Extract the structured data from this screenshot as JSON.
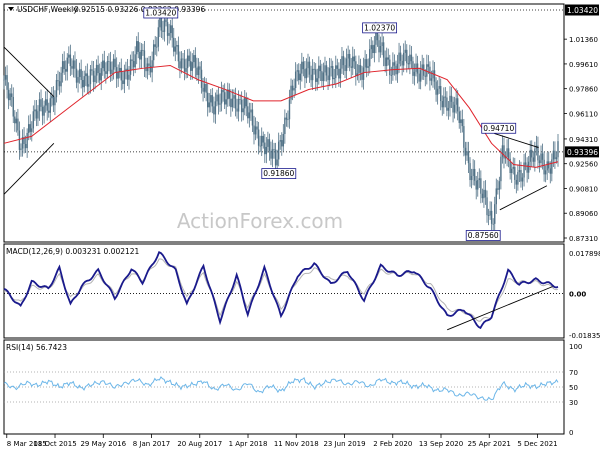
{
  "colors": {
    "background": "#ffffff",
    "candle": "#4f7085",
    "sma": "#e0232b",
    "macd_line": "#1a1a8c",
    "macd_signal": "#b4b4b4",
    "rsi_line": "#6cb6e8",
    "axis": "#000000",
    "grid": "#9a9a9a",
    "label_box": "#1a1a8c",
    "price_badge_bg": "#000000",
    "price_badge_fg": "#ffffff",
    "watermark": "#c8c8c8"
  },
  "watermark": "ActionForex.com",
  "price_panel": {
    "title": "USDCHF,Weekly",
    "ohlc": "0.92515 0.93226 0.92362 0.93396",
    "ylim": [
      0.8731,
      1.0342
    ],
    "y_ticks": [
      "1.03420",
      "1.01360",
      "0.99610",
      "0.97860",
      "0.96110",
      "0.94310",
      "0.92560",
      "0.90810",
      "0.89060",
      "0.87310"
    ],
    "current_price": "0.93396",
    "current_value": 0.93396,
    "top_value": 1.0342,
    "top_label": "1.03420",
    "annotations": [
      {
        "text": "1.03420",
        "x": 28.3,
        "y": 1.0342
      },
      {
        "text": "0.91860",
        "x": 49.6,
        "y": 0.9186
      },
      {
        "text": "1.02370",
        "x": 67.8,
        "y": 1.0237
      },
      {
        "text": "0.94710",
        "x": 89.3,
        "y": 0.9471
      },
      {
        "text": "0.87560",
        "x": 86.5,
        "y": 0.8756
      }
    ]
  },
  "macd_panel": {
    "title": "MACD(12,26,9) 0.003231 0.002121",
    "ylim": [
      -0.0183,
      0.0178
    ],
    "y_ticks": [
      "0.017898",
      "0.00",
      "-0.018354"
    ],
    "current_value": 0.0
  },
  "rsi_panel": {
    "title": "RSI(14) 56.7423",
    "ylim": [
      0,
      100
    ],
    "y_ticks": [
      "100",
      "70",
      "50",
      "30",
      "0"
    ]
  },
  "x_ticks": [
    "8 Mar 2015",
    "18 Oct 2015",
    "29 May 2016",
    "8 Jan 2017",
    "20 Aug 2017",
    "1 Apr 2018",
    "11 Nov 2018",
    "23 Jun 2019",
    "2 Feb 2020",
    "13 Sep 2020",
    "25 Apr 2021",
    "5 Dec 2021"
  ],
  "chart_data": {
    "type": "candlestick",
    "title": "USDCHF,Weekly",
    "x_unit": "date",
    "x_range": [
      "2015-03-08",
      "2022-02-13"
    ],
    "price": {
      "x": [
        0,
        3,
        6,
        9,
        12,
        15,
        18,
        21,
        24,
        26,
        28,
        30,
        32,
        35,
        38,
        41,
        44,
        47,
        49,
        52,
        55,
        58,
        61,
        64,
        67,
        70,
        73,
        76,
        79,
        82,
        84,
        86,
        88,
        90,
        92,
        94,
        96,
        98,
        100
      ],
      "close": [
        0.985,
        0.94,
        0.96,
        0.975,
        1.0,
        0.98,
        0.998,
        0.985,
        1.005,
        0.99,
        1.025,
        1.015,
        1.0,
        0.99,
        0.965,
        0.975,
        0.96,
        0.94,
        0.925,
        0.98,
        0.995,
        0.985,
        0.998,
        0.99,
        1.01,
        0.995,
        0.998,
        0.99,
        0.975,
        0.96,
        0.925,
        0.905,
        0.885,
        0.935,
        0.915,
        0.925,
        0.93,
        0.925,
        0.934
      ]
    },
    "sma": {
      "x": [
        0,
        5,
        10,
        15,
        20,
        25,
        30,
        35,
        40,
        45,
        50,
        55,
        60,
        65,
        70,
        75,
        80,
        84,
        88,
        92,
        96,
        100
      ],
      "values": [
        0.94,
        0.945,
        0.96,
        0.975,
        0.99,
        0.993,
        0.995,
        0.985,
        0.978,
        0.97,
        0.97,
        0.978,
        0.982,
        0.99,
        0.992,
        0.993,
        0.985,
        0.965,
        0.94,
        0.925,
        0.923,
        0.927
      ]
    },
    "macd": {
      "x": [
        0,
        3,
        5,
        8,
        10,
        12,
        14,
        17,
        20,
        23,
        25,
        28,
        31,
        33,
        36,
        39,
        42,
        44,
        47,
        50,
        53,
        56,
        59,
        62,
        65,
        68,
        71,
        74,
        77,
        80,
        83,
        86,
        88,
        91,
        93,
        96,
        100
      ],
      "line": [
        0.002,
        -0.006,
        0.005,
        0.002,
        0.011,
        -0.005,
        0.003,
        0.01,
        -0.002,
        0.011,
        0.005,
        0.018,
        0.01,
        -0.005,
        0.012,
        -0.012,
        0.008,
        -0.009,
        0.011,
        -0.01,
        0.008,
        0.013,
        0.004,
        0.01,
        -0.003,
        0.012,
        0.008,
        0.01,
        0.002,
        -0.01,
        -0.007,
        -0.015,
        -0.01,
        0.01,
        0.004,
        0.006,
        0.003
      ],
      "signal": [
        0.001,
        -0.004,
        0.003,
        0.002,
        0.008,
        -0.002,
        0.002,
        0.008,
        0.0,
        0.009,
        0.006,
        0.015,
        0.011,
        -0.002,
        0.009,
        -0.009,
        0.005,
        -0.006,
        0.008,
        -0.007,
        0.006,
        0.011,
        0.006,
        0.008,
        0.0,
        0.01,
        0.008,
        0.009,
        0.004,
        -0.007,
        -0.008,
        -0.012,
        -0.01,
        0.006,
        0.005,
        0.005,
        0.002
      ]
    },
    "rsi": {
      "x": [
        0,
        2,
        4,
        6,
        8,
        10,
        12,
        14,
        16,
        18,
        20,
        22,
        24,
        26,
        28,
        30,
        32,
        34,
        36,
        38,
        40,
        42,
        44,
        46,
        48,
        50,
        52,
        54,
        56,
        58,
        60,
        62,
        64,
        66,
        68,
        70,
        72,
        74,
        76,
        78,
        80,
        82,
        84,
        86,
        88,
        90,
        92,
        94,
        96,
        98,
        100
      ],
      "values": [
        55,
        48,
        56,
        52,
        58,
        50,
        56,
        48,
        54,
        57,
        50,
        55,
        60,
        52,
        62,
        56,
        50,
        53,
        58,
        46,
        54,
        45,
        56,
        42,
        52,
        44,
        58,
        60,
        50,
        56,
        60,
        53,
        58,
        50,
        61,
        55,
        57,
        50,
        53,
        45,
        47,
        38,
        42,
        35,
        33,
        55,
        46,
        53,
        50,
        55,
        56.7
      ]
    },
    "trendlines": [
      {
        "panel": "price",
        "points": [
          [
            0,
            1.008
          ],
          [
            9,
            0.973
          ]
        ]
      },
      {
        "panel": "price",
        "points": [
          [
            0,
            0.904
          ],
          [
            9,
            0.94
          ]
        ]
      },
      {
        "panel": "price",
        "points": [
          [
            88.5,
            0.947
          ],
          [
            96.5,
            0.937
          ]
        ]
      },
      {
        "panel": "price",
        "points": [
          [
            89.5,
            0.893
          ],
          [
            98,
            0.91
          ]
        ]
      },
      {
        "panel": "macd",
        "points": [
          [
            80,
            -0.016
          ],
          [
            99,
            0.003
          ]
        ]
      }
    ]
  }
}
